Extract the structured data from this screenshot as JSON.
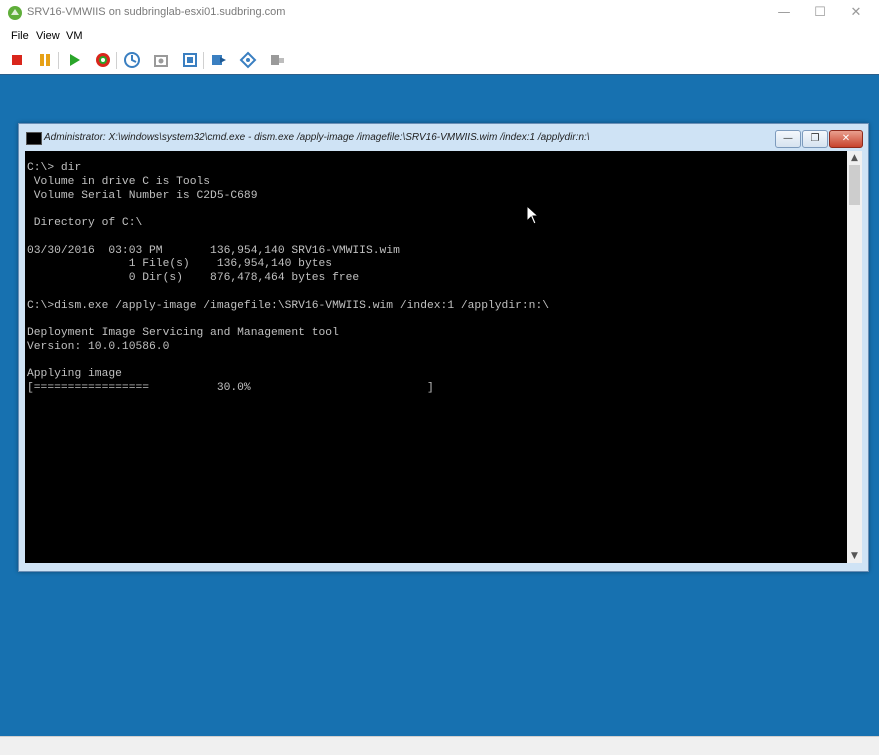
{
  "window": {
    "title": "SRV16-VMWIIS on sudbringlab-esxi01.sudbring.com",
    "controls": {
      "minimize": "—",
      "maximize": "☐",
      "close": "✕"
    }
  },
  "menu": [
    "File",
    "View",
    "VM"
  ],
  "toolbar": {
    "buttons": [
      {
        "name": "power-off-icon",
        "color": "#d9261c"
      },
      {
        "name": "suspend-icon",
        "color": "#e6a117"
      },
      {
        "name": "power-on-icon",
        "color": "#2aa52a"
      },
      {
        "name": "reset-icon",
        "color": "#d9261c"
      },
      {
        "name": "snapshot-icon",
        "color": "#3a7fc1"
      },
      {
        "name": "revert-snapshot-icon",
        "color": "#9a9a9a"
      },
      {
        "name": "manage-snapshots-icon",
        "color": "#3a7fc1"
      },
      {
        "name": "send-ctrl-alt-del-icon",
        "color": "#3a7fc1"
      },
      {
        "name": "connect-devices-icon",
        "color": "#3a7fc1"
      },
      {
        "name": "vm-settings-icon",
        "color": "#9a9a9a"
      }
    ]
  },
  "cmd": {
    "title": "Administrator: X:\\windows\\system32\\cmd.exe - dism.exe  /apply-image /imagefile:\\SRV16-VMWIIS.wim /index:1 /applydir:n:\\",
    "controls": {
      "minimize": "—",
      "maximize": "❐",
      "close": "✕"
    },
    "lines": [
      "C:\\> dir",
      " Volume in drive C is Tools",
      " Volume Serial Number is C2D5-C689",
      "",
      " Directory of C:\\",
      "",
      "03/30/2016  03:03 PM       136,954,140 SRV16-VMWIIS.wim",
      "               1 File(s)    136,954,140 bytes",
      "               0 Dir(s)    876,478,464 bytes free",
      "",
      "C:\\>dism.exe /apply-image /imagefile:\\SRV16-VMWIIS.wim /index:1 /applydir:n:\\",
      "",
      "Deployment Image Servicing and Management tool",
      "Version: 10.0.10586.0",
      "",
      "Applying image",
      "[=================          30.0%                          ]"
    ]
  },
  "colors": {
    "vm_background": "#1771b0",
    "console_background": "#000000",
    "console_text": "#c0c0c0"
  }
}
